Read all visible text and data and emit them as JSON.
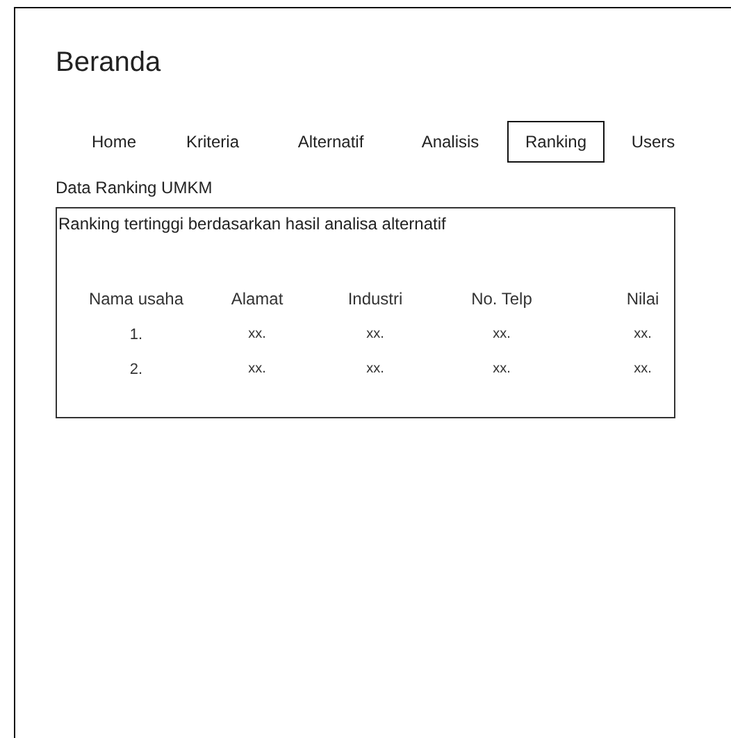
{
  "page_title": "Beranda",
  "tabs": [
    {
      "label": "Home",
      "selected": false
    },
    {
      "label": "Kriteria",
      "selected": false
    },
    {
      "label": "Alternatif",
      "selected": false
    },
    {
      "label": "Analisis",
      "selected": false
    },
    {
      "label": "Ranking",
      "selected": true
    },
    {
      "label": "Users",
      "selected": false
    }
  ],
  "section_title": "Data Ranking UMKM",
  "panel": {
    "subtitle": "Ranking tertinggi berdasarkan hasil analisa alternatif",
    "columns": [
      "Nama usaha",
      "Alamat",
      "Industri",
      "No. Telp",
      "Nilai"
    ],
    "rows": [
      [
        "1.",
        "xx.",
        "xx.",
        "xx.",
        "xx."
      ],
      [
        "2.",
        "xx.",
        "xx.",
        "xx.",
        "xx."
      ]
    ]
  }
}
